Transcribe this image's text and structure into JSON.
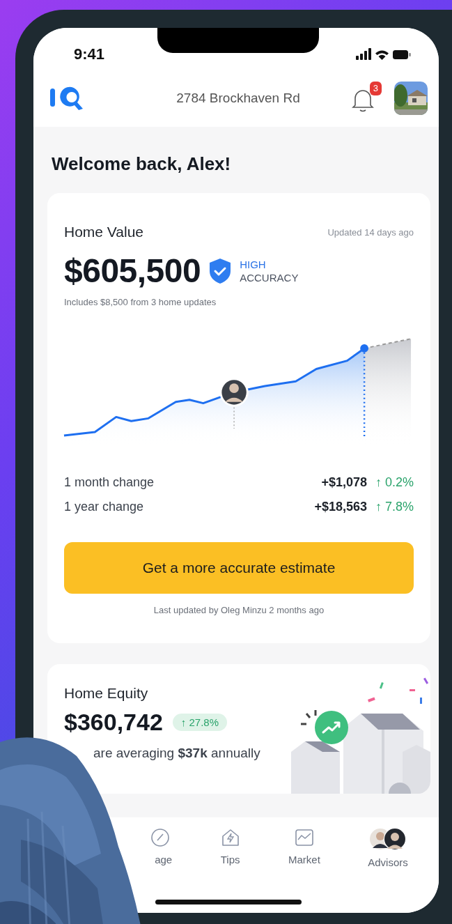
{
  "status_bar": {
    "time": "9:41"
  },
  "header": {
    "address": "2784 Brockhaven Rd",
    "notifications": "3"
  },
  "greeting": "Welcome back, Alex!",
  "home_value": {
    "title": "Home Value",
    "updated": "Updated 14 days ago",
    "value": "$605,500",
    "accuracy": [
      "HIGH",
      "ACCURACY"
    ],
    "note": "Includes $8,500 from 3 home updates",
    "changes": [
      {
        "label": "1 month change",
        "amount": "+$1,078",
        "percent": "↑ 0.2%"
      },
      {
        "label": "1 year change",
        "amount": "+$18,563",
        "percent": "↑ 7.8%"
      }
    ],
    "button": "Get a more accurate estimate",
    "caption": "Last updated by Oleg Minzu 2 months ago"
  },
  "home_equity": {
    "title": "Home Equity",
    "value": "$360,742",
    "badge": "↑ 27.8%",
    "summary": "are averaging **$37k** annually"
  },
  "nav": [
    {
      "label": "age",
      "kind": "gauge"
    },
    {
      "label": "Tips",
      "kind": "tips"
    },
    {
      "label": "Market",
      "kind": "market"
    },
    {
      "label": "Advisors",
      "kind": "advisors"
    }
  ]
}
